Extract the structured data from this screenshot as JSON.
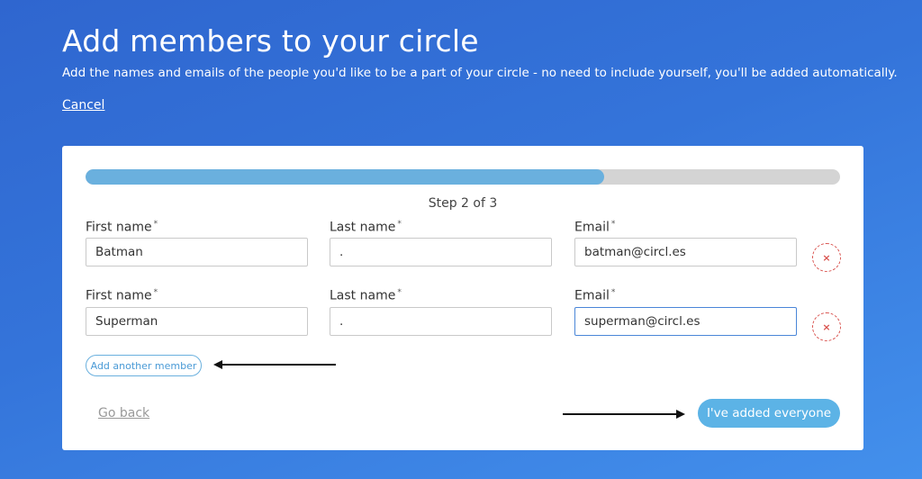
{
  "header": {
    "title": "Add members to your circle",
    "subtitle": "Add the names and emails of the people you'd like to be a part of your circle - no need to include yourself, you'll be added automatically.",
    "cancel_label": "Cancel"
  },
  "progress": {
    "fraction": 0.687,
    "step_label": "Step 2 of 3"
  },
  "labels": {
    "first_name": "First name",
    "last_name": "Last name",
    "email": "Email",
    "required_mark": "*"
  },
  "members": [
    {
      "first_name": "Batman",
      "last_name": ".",
      "email": "batman@circl.es"
    },
    {
      "first_name": "Superman",
      "last_name": ".",
      "email": "superman@circl.es"
    }
  ],
  "remove_icon": "×",
  "actions": {
    "add_member_label": "Add another member",
    "go_back_label": "Go back",
    "done_label": "I've added everyone"
  },
  "colors": {
    "accent": "#5cb3e6",
    "progress_fill": "#6ab0de",
    "remove": "#d9534f"
  }
}
